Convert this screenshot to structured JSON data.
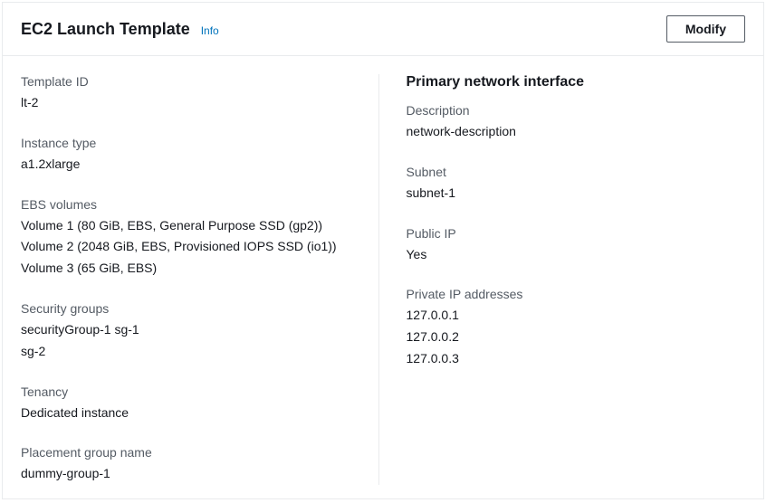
{
  "header": {
    "title": "EC2 Launch Template",
    "info_label": "Info",
    "modify_label": "Modify"
  },
  "left": {
    "template_id": {
      "label": "Template ID",
      "value": "lt-2"
    },
    "instance_type": {
      "label": "Instance type",
      "value": "a1.2xlarge"
    },
    "ebs_volumes": {
      "label": "EBS volumes",
      "items": [
        "Volume 1 (80 GiB, EBS, General Purpose SSD (gp2))",
        "Volume 2 (2048 GiB, EBS, Provisioned IOPS SSD (io1))",
        "Volume 3 (65 GiB, EBS)"
      ]
    },
    "security_groups": {
      "label": "Security groups",
      "items": [
        "securityGroup-1 sg-1",
        "sg-2"
      ]
    },
    "tenancy": {
      "label": "Tenancy",
      "value": "Dedicated instance"
    },
    "placement_group": {
      "label": "Placement group name",
      "value": "dummy-group-1"
    }
  },
  "right": {
    "heading": "Primary network interface",
    "description": {
      "label": "Description",
      "value": "network-description"
    },
    "subnet": {
      "label": "Subnet",
      "value": "subnet-1"
    },
    "public_ip": {
      "label": "Public IP",
      "value": "Yes"
    },
    "private_ips": {
      "label": "Private IP addresses",
      "items": [
        "127.0.0.1",
        "127.0.0.2",
        "127.0.0.3"
      ]
    }
  }
}
